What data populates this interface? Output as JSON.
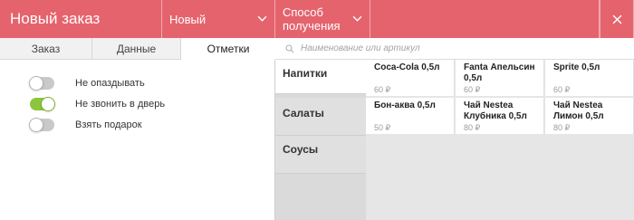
{
  "header": {
    "title": "Новый заказ",
    "status": "Новый",
    "delivery": "Способ получения"
  },
  "tabs": [
    {
      "label": "Заказ"
    },
    {
      "label": "Данные"
    },
    {
      "label": "Отметки",
      "active": true
    }
  ],
  "toggles": [
    {
      "label": "Не опаздывать",
      "on": false
    },
    {
      "label": "Не звонить в дверь",
      "on": true
    },
    {
      "label": "Взять подарок",
      "on": false
    }
  ],
  "search": {
    "placeholder": "Наименование или артикул"
  },
  "categories": [
    {
      "label": "Напитки",
      "active": true
    },
    {
      "label": "Салаты"
    },
    {
      "label": "Соусы"
    }
  ],
  "products": [
    {
      "name": "Coca-Cola 0,5л",
      "price": "60 ₽"
    },
    {
      "name": "Fanta Апельсин 0,5л",
      "price": "60 ₽"
    },
    {
      "name": "Sprite 0,5л",
      "price": "60 ₽"
    },
    {
      "name": "Бон-аква 0,5л",
      "price": "50 ₽"
    },
    {
      "name": "Чай Nestea Клубника 0,5л",
      "price": "80 ₽"
    },
    {
      "name": "Чай Nestea Лимон 0,5л",
      "price": "80 ₽"
    }
  ],
  "colors": {
    "accent": "#e5636d",
    "toggle_on": "#8cc63e"
  }
}
